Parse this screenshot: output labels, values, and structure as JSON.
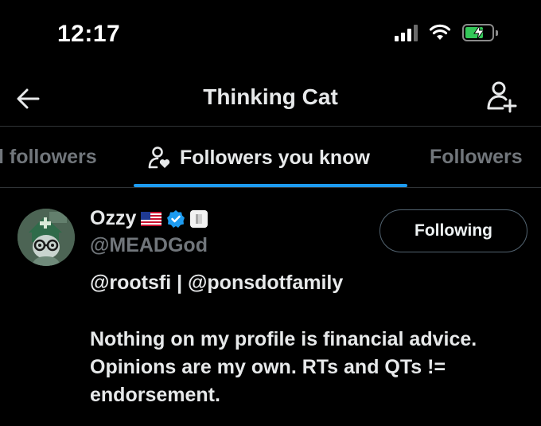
{
  "status_bar": {
    "time": "12:17"
  },
  "nav": {
    "title": "Thinking Cat",
    "back_icon": "arrow-left-icon",
    "add_icon": "add-user-icon"
  },
  "tabs": [
    {
      "label": "l followers"
    },
    {
      "label": "Followers you know",
      "active": true
    },
    {
      "label": "Followers"
    }
  ],
  "colors": {
    "background": "#000000",
    "accent": "#1d9bf0",
    "muted": "#71767b",
    "battery": "#34c759"
  },
  "users": [
    {
      "name": "Ozzy",
      "handle": "@MEADGod",
      "follow_label": "Following",
      "bio_line_1": "@rootsfi | @ponsdotfamily",
      "bio_line_2": "Nothing on my profile is financial advice.",
      "bio_line_3": "Opinions are my own. RTs and QTs !=",
      "bio_line_4": "endorsement."
    }
  ]
}
